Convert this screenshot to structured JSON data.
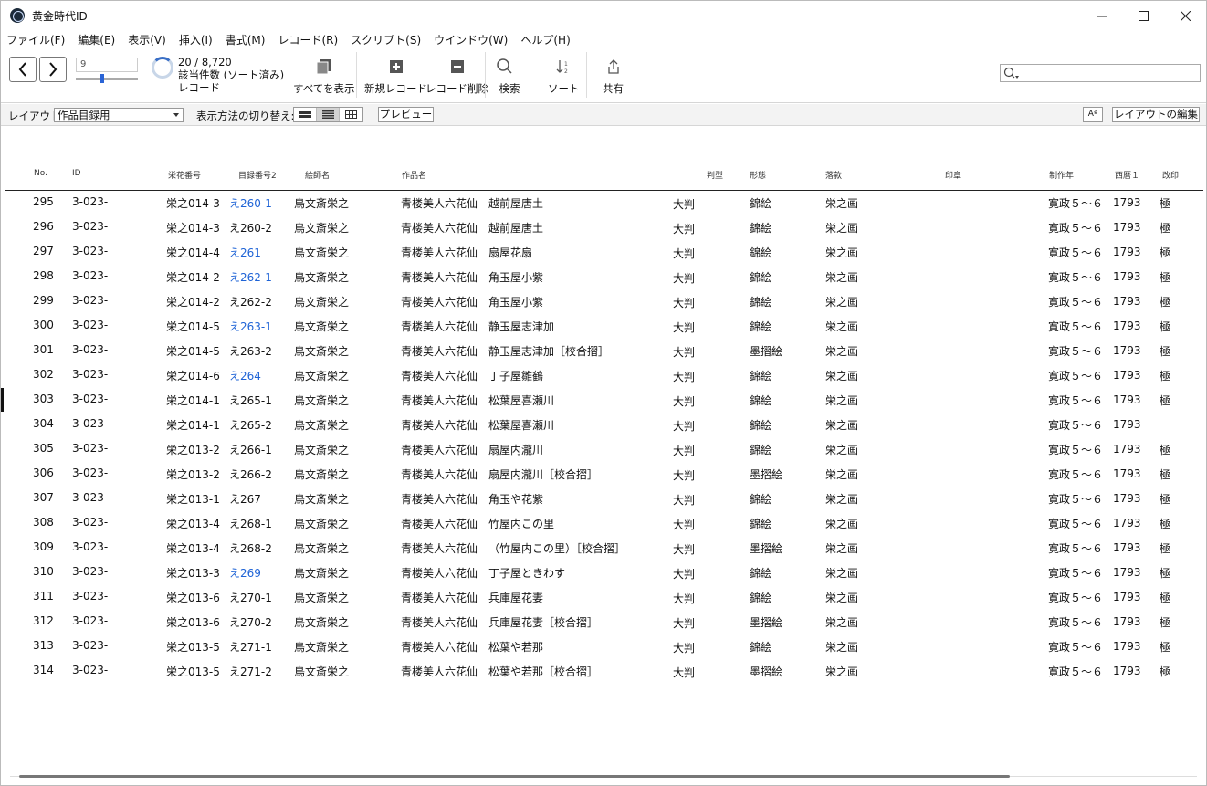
{
  "window": {
    "title": "黄金時代ID"
  },
  "menu": [
    "ファイル(F)",
    "編集(E)",
    "表示(V)",
    "挿入(I)",
    "書式(M)",
    "レコード(R)",
    "スクリプト(S)",
    "ウインドウ(W)",
    "ヘルプ(H)"
  ],
  "toolbar": {
    "record_number": "9",
    "found_count": "20 / 8,720",
    "found_label": "該当件数 (ソート済み)",
    "records_label": "レコード",
    "show_all": "すべてを表示",
    "new_record": "新規レコード",
    "delete_record": "レコード削除",
    "find": "検索",
    "sort": "ソート",
    "share": "共有"
  },
  "layoutbar": {
    "layout_label": "レイアウト:",
    "layout_value": "作品目録用",
    "view_as_label": "表示方法の切り替え:",
    "preview": "プレビュー",
    "aa": "Aª",
    "edit_layout": "レイアウトの編集"
  },
  "table": {
    "headers": [
      "No.",
      "ID",
      "栄花番号",
      "目録番号2",
      "絵師名",
      "作品名",
      "判型",
      "形態",
      "落款",
      "印章",
      "制作年",
      "西暦１",
      "改印"
    ],
    "rows": [
      {
        "no": "295",
        "id": "3-023-",
        "eika": "栄之014-3",
        "mokuroku": "え260-1",
        "link": true,
        "artist": "鳥文斎栄之",
        "series": "青楼美人六花仙",
        "title": "越前屋唐土",
        "size": "大判",
        "form": "錦絵",
        "sign": "栄之画",
        "era": "寛政５～６",
        "year": "1793",
        "seal": "極"
      },
      {
        "no": "296",
        "id": "3-023-",
        "eika": "栄之014-3",
        "mokuroku": "え260-2",
        "link": false,
        "artist": "鳥文斎栄之",
        "series": "青楼美人六花仙",
        "title": "越前屋唐土",
        "size": "大判",
        "form": "錦絵",
        "sign": "栄之画",
        "era": "寛政５～６",
        "year": "1793",
        "seal": "極"
      },
      {
        "no": "297",
        "id": "3-023-",
        "eika": "栄之014-4",
        "mokuroku": "え261",
        "link": true,
        "artist": "鳥文斎栄之",
        "series": "青楼美人六花仙",
        "title": "扇屋花扇",
        "size": "大判",
        "form": "錦絵",
        "sign": "栄之画",
        "era": "寛政５～６",
        "year": "1793",
        "seal": "極"
      },
      {
        "no": "298",
        "id": "3-023-",
        "eika": "栄之014-2",
        "mokuroku": "え262-1",
        "link": true,
        "artist": "鳥文斎栄之",
        "series": "青楼美人六花仙",
        "title": "角玉屋小紫",
        "size": "大判",
        "form": "錦絵",
        "sign": "栄之画",
        "era": "寛政５～６",
        "year": "1793",
        "seal": "極"
      },
      {
        "no": "299",
        "id": "3-023-",
        "eika": "栄之014-2",
        "mokuroku": "え262-2",
        "link": false,
        "artist": "鳥文斎栄之",
        "series": "青楼美人六花仙",
        "title": "角玉屋小紫",
        "size": "大判",
        "form": "錦絵",
        "sign": "栄之画",
        "era": "寛政５～６",
        "year": "1793",
        "seal": "極"
      },
      {
        "no": "300",
        "id": "3-023-",
        "eika": "栄之014-5",
        "mokuroku": "え263-1",
        "link": true,
        "artist": "鳥文斎栄之",
        "series": "青楼美人六花仙",
        "title": "静玉屋志津加",
        "size": "大判",
        "form": "錦絵",
        "sign": "栄之画",
        "era": "寛政５～６",
        "year": "1793",
        "seal": "極"
      },
      {
        "no": "301",
        "id": "3-023-",
        "eika": "栄之014-5",
        "mokuroku": "え263-2",
        "link": false,
        "artist": "鳥文斎栄之",
        "series": "青楼美人六花仙",
        "title": "静玉屋志津加［校合摺］",
        "size": "大判",
        "form": "墨摺絵",
        "sign": "栄之画",
        "era": "寛政５～６",
        "year": "1793",
        "seal": "極"
      },
      {
        "no": "302",
        "id": "3-023-",
        "eika": "栄之014-6",
        "mokuroku": "え264",
        "link": true,
        "artist": "鳥文斎栄之",
        "series": "青楼美人六花仙",
        "title": "丁子屋雛鶴",
        "size": "大判",
        "form": "錦絵",
        "sign": "栄之画",
        "era": "寛政５～６",
        "year": "1793",
        "seal": "極"
      },
      {
        "no": "303",
        "id": "3-023-",
        "eika": "栄之014-1",
        "mokuroku": "え265-1",
        "link": false,
        "artist": "鳥文斎栄之",
        "series": "青楼美人六花仙",
        "title": "松葉屋喜瀬川",
        "size": "大判",
        "form": "錦絵",
        "sign": "栄之画",
        "era": "寛政５～６",
        "year": "1793",
        "seal": "極"
      },
      {
        "no": "304",
        "id": "3-023-",
        "eika": "栄之014-1",
        "mokuroku": "え265-2",
        "link": false,
        "artist": "鳥文斎栄之",
        "series": "青楼美人六花仙",
        "title": "松葉屋喜瀬川",
        "size": "大判",
        "form": "錦絵",
        "sign": "栄之画",
        "era": "寛政５～６",
        "year": "1793",
        "seal": ""
      },
      {
        "no": "305",
        "id": "3-023-",
        "eika": "栄之013-2",
        "mokuroku": "え266-1",
        "link": false,
        "artist": "鳥文斎栄之",
        "series": "青楼美人六花仙",
        "title": "扇屋内瀧川",
        "size": "大判",
        "form": "錦絵",
        "sign": "栄之画",
        "era": "寛政５～６",
        "year": "1793",
        "seal": "極"
      },
      {
        "no": "306",
        "id": "3-023-",
        "eika": "栄之013-2",
        "mokuroku": "え266-2",
        "link": false,
        "artist": "鳥文斎栄之",
        "series": "青楼美人六花仙",
        "title": "扇屋内瀧川［校合摺］",
        "size": "大判",
        "form": "墨摺絵",
        "sign": "栄之画",
        "era": "寛政５～６",
        "year": "1793",
        "seal": "極"
      },
      {
        "no": "307",
        "id": "3-023-",
        "eika": "栄之013-1",
        "mokuroku": "え267",
        "link": false,
        "artist": "鳥文斎栄之",
        "series": "青楼美人六花仙",
        "title": "角玉や花紫",
        "size": "大判",
        "form": "錦絵",
        "sign": "栄之画",
        "era": "寛政５～６",
        "year": "1793",
        "seal": "極"
      },
      {
        "no": "308",
        "id": "3-023-",
        "eika": "栄之013-4",
        "mokuroku": "え268-1",
        "link": false,
        "artist": "鳥文斎栄之",
        "series": "青楼美人六花仙",
        "title": "竹屋内この里",
        "size": "大判",
        "form": "錦絵",
        "sign": "栄之画",
        "era": "寛政５～６",
        "year": "1793",
        "seal": "極"
      },
      {
        "no": "309",
        "id": "3-023-",
        "eika": "栄之013-4",
        "mokuroku": "え268-2",
        "link": false,
        "artist": "鳥文斎栄之",
        "series": "青楼美人六花仙",
        "title": "（竹屋内この里）［校合摺］",
        "size": "大判",
        "form": "墨摺絵",
        "sign": "栄之画",
        "era": "寛政５～６",
        "year": "1793",
        "seal": "極"
      },
      {
        "no": "310",
        "id": "3-023-",
        "eika": "栄之013-3",
        "mokuroku": "え269",
        "link": true,
        "artist": "鳥文斎栄之",
        "series": "青楼美人六花仙",
        "title": "丁子屋ときわす",
        "size": "大判",
        "form": "錦絵",
        "sign": "栄之画",
        "era": "寛政５～６",
        "year": "1793",
        "seal": "極"
      },
      {
        "no": "311",
        "id": "3-023-",
        "eika": "栄之013-6",
        "mokuroku": "え270-1",
        "link": false,
        "artist": "鳥文斎栄之",
        "series": "青楼美人六花仙",
        "title": "兵庫屋花妻",
        "size": "大判",
        "form": "錦絵",
        "sign": "栄之画",
        "era": "寛政５～６",
        "year": "1793",
        "seal": "極"
      },
      {
        "no": "312",
        "id": "3-023-",
        "eika": "栄之013-6",
        "mokuroku": "え270-2",
        "link": false,
        "artist": "鳥文斎栄之",
        "series": "青楼美人六花仙",
        "title": "兵庫屋花妻［校合摺］",
        "size": "大判",
        "form": "墨摺絵",
        "sign": "栄之画",
        "era": "寛政５～６",
        "year": "1793",
        "seal": "極"
      },
      {
        "no": "313",
        "id": "3-023-",
        "eika": "栄之013-5",
        "mokuroku": "え271-1",
        "link": false,
        "artist": "鳥文斎栄之",
        "series": "青楼美人六花仙",
        "title": "松葉や若那",
        "size": "大判",
        "form": "錦絵",
        "sign": "栄之画",
        "era": "寛政５～６",
        "year": "1793",
        "seal": "極"
      },
      {
        "no": "314",
        "id": "3-023-",
        "eika": "栄之013-5",
        "mokuroku": "え271-2",
        "link": false,
        "artist": "鳥文斎栄之",
        "series": "青楼美人六花仙",
        "title": "松葉や若那［校合摺］",
        "size": "大判",
        "form": "墨摺絵",
        "sign": "栄之画",
        "era": "寛政５～６",
        "year": "1793",
        "seal": "極"
      }
    ]
  },
  "colors": {
    "link": "#1e63d6",
    "accent": "#2a64d6"
  }
}
